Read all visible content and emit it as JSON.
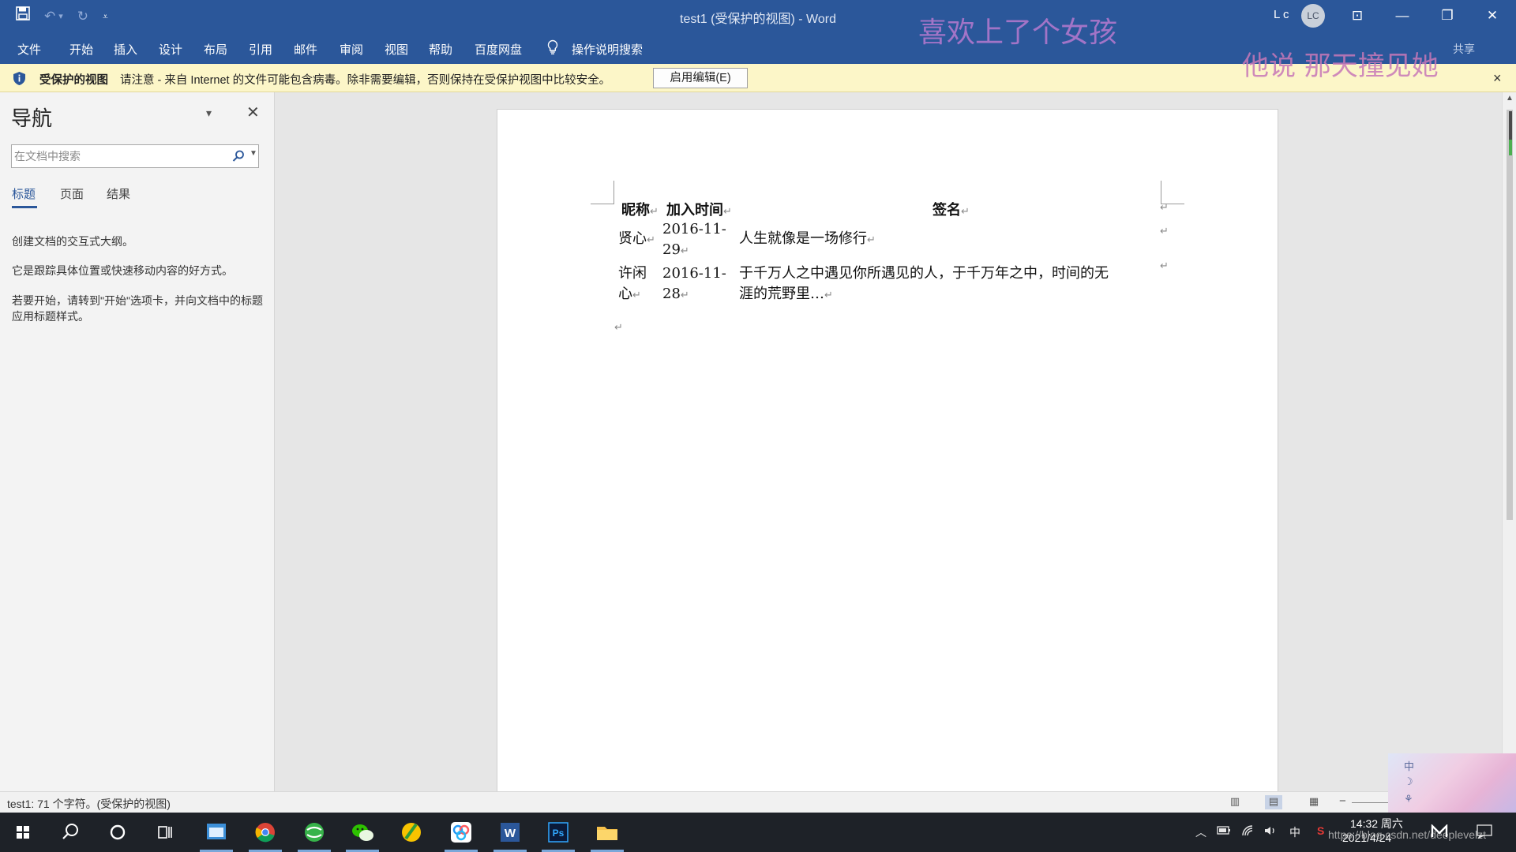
{
  "window": {
    "title": "test1 (受保护的视图)  -  Word",
    "user_name": "L c",
    "user_initials": "LC",
    "minimize": "—",
    "restore": "❐",
    "close": "✕",
    "ribbon_display": "⊡"
  },
  "qat": {
    "save": "💾",
    "undo": "↶",
    "undo_caret": "▾",
    "redo": "↻",
    "customize": "⩡"
  },
  "ribbon": {
    "tabs": [
      "文件",
      "开始",
      "插入",
      "设计",
      "布局",
      "引用",
      "邮件",
      "审阅",
      "视图",
      "帮助",
      "百度网盘"
    ],
    "tell_me": "操作说明搜索",
    "share": "共享"
  },
  "overlay": {
    "line1": "喜欢上了个女孩",
    "line2": "他说  那天撞见她"
  },
  "protected_view": {
    "title": "受保护的视图",
    "message": "请注意 - 来自 Internet 的文件可能包含病毒。除非需要编辑，否则保持在受保护视图中比较安全。",
    "enable_button": "启用编辑(E)",
    "close": "×"
  },
  "nav": {
    "title": "导航",
    "menu": "▾",
    "close": "✕",
    "search_placeholder": "在文档中搜索",
    "tabs": [
      "标题",
      "页面",
      "结果"
    ],
    "text1": "创建文档的交互式大纲。",
    "text2": "它是跟踪具体位置或快速移动内容的好方式。",
    "text3": "若要开始，请转到\"开始\"选项卡，并向文档中的标题应用标题样式。"
  },
  "document": {
    "headers": [
      "昵称",
      "加入时间",
      "签名"
    ],
    "rows": [
      {
        "name": "贤心",
        "date_line1": "2016-11-",
        "date_line2": "29",
        "sig_line1": "人生就像是一场修行",
        "sig_line2": ""
      },
      {
        "name_line1": "许闲",
        "name_line2": "心",
        "date_line1": "2016-11-",
        "date_line2": "28",
        "sig_line1": "于千万人之中遇见你所遇见的人，于千万年之中，时间的无",
        "sig_line2": "涯的荒野里…"
      }
    ],
    "cell_mark": "↵",
    "para_mark": "↵"
  },
  "status": {
    "text": "test1: 71 个字符。(受保护的视图)",
    "zoom_minus": "−"
  },
  "art": {
    "ime1": "中",
    "ime2": "☽",
    "ime3": "⚘"
  },
  "taskbar": {
    "time": "14:32 周六",
    "date": "2021/4/24",
    "watermark": "https://blog.csdn.net/deeplevelzt",
    "ime": "中",
    "sogou": "S"
  },
  "colors": {
    "accent": "#2b579a",
    "pv_bar": "#fcf6c8",
    "overlay": "#b77ad0"
  }
}
